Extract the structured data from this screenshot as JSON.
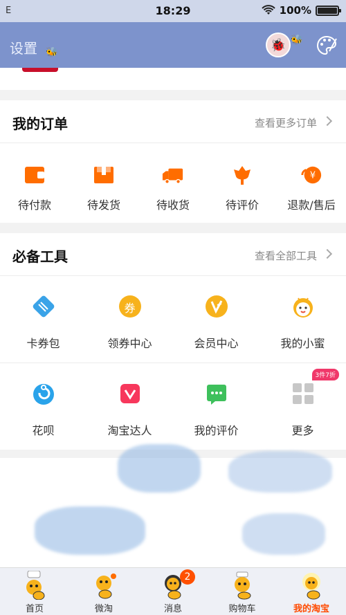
{
  "status": {
    "carrier": "E",
    "time": "18:29",
    "battery": "100%",
    "battery_level": 1.0
  },
  "nav": {
    "title": "设置"
  },
  "orders": {
    "title": "我的订单",
    "more": "查看更多订单",
    "items": [
      {
        "label": "待付款",
        "icon": "wallet-icon"
      },
      {
        "label": "待发货",
        "icon": "package-icon"
      },
      {
        "label": "待收货",
        "icon": "truck-icon"
      },
      {
        "label": "待评价",
        "icon": "flower-icon"
      },
      {
        "label": "退款/售后",
        "icon": "refund-icon"
      }
    ]
  },
  "tools": {
    "title": "必备工具",
    "more": "查看全部工具",
    "row1": [
      {
        "label": "卡券包",
        "icon": "ticket-icon"
      },
      {
        "label": "领券中心",
        "icon": "coupon-icon",
        "glyph": "券"
      },
      {
        "label": "会员中心",
        "icon": "vip-icon"
      },
      {
        "label": "我的小蜜",
        "icon": "assistant-icon"
      }
    ],
    "row2": [
      {
        "label": "花呗",
        "icon": "huabei-icon"
      },
      {
        "label": "淘宝达人",
        "icon": "taobao-expert-icon"
      },
      {
        "label": "我的评价",
        "icon": "review-icon"
      },
      {
        "label": "更多",
        "icon": "more-grid-icon",
        "tag": "3件7折"
      }
    ]
  },
  "tabbar": {
    "items": [
      {
        "label": "首页",
        "icon": "home-bee-icon"
      },
      {
        "label": "微淘",
        "icon": "weitao-bee-icon"
      },
      {
        "label": "消息",
        "icon": "message-bee-icon",
        "count": "2"
      },
      {
        "label": "购物车",
        "icon": "cart-bee-icon"
      },
      {
        "label": "我的淘宝",
        "icon": "my-taobao-bee-icon"
      }
    ],
    "active": 4
  },
  "colors": {
    "header": "#7d93cc",
    "accent": "#ff5000",
    "order_icon": "#ff6d00",
    "badge": "#f0386a"
  }
}
